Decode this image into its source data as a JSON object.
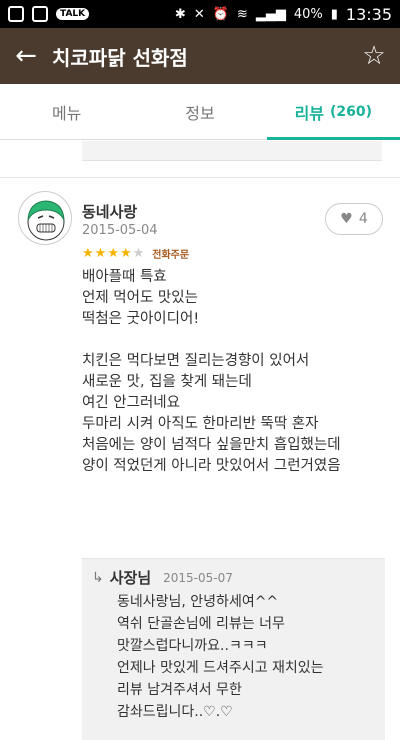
{
  "statusbar": {
    "time": "13:35",
    "battery": "40%",
    "talk_badge": "TALK"
  },
  "appbar": {
    "title": "치코파닭 선화점"
  },
  "tabs": [
    {
      "label": "메뉴"
    },
    {
      "label": "정보"
    },
    {
      "label": "리뷰",
      "count": "(260)"
    }
  ],
  "review": {
    "author": "동네사랑",
    "date": "2015-05-04",
    "likes": "4",
    "rating": 4,
    "rating_max": 5,
    "order_type": "전화주문",
    "text": "배아플때 특효\n언제 먹어도 맛있는\n떡첨은 굿아이디어!\n\n치킨은 먹다보면  질리는경향이 있어서\n새로운 맛, 집을 찾게 돼는데\n여긴 안그러네요\n두마리 시켜  아직도 한마리반 뚝딱 혼자\n처음에는 양이 넘적다 싶을만치 흡입했는데\n양이 적었던게 아니라 맛있어서 그런거였음"
  },
  "reply": {
    "author": "사장님",
    "date": "2015-05-07",
    "text": "동네사랑님, 안녕하세여^^\n역쉬 단골손님에 리뷰는 너무\n맛깔스럽다니까요..ㅋㅋㅋ\n언제나 맛있게 드셔주시고 재치있는\n리뷰 남겨주셔서 무한\n감솨드립니다..♡.♡"
  },
  "colors": {
    "appbar_bg": "#4b3b2e",
    "accent": "#19b29a",
    "star_on": "#f4b400"
  }
}
